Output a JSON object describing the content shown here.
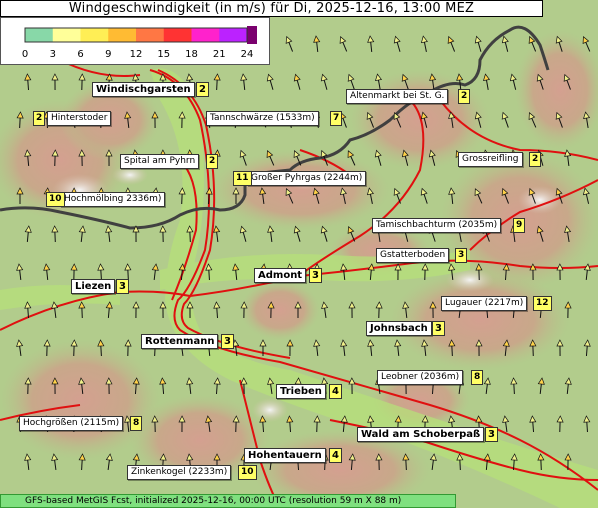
{
  "title": "Windgeschwindigkeit (in m/s) für Di, 2025-12-16, 13:00 MEZ",
  "legend": {
    "ticks": [
      "0",
      "3",
      "6",
      "9",
      "12",
      "15",
      "18",
      "21",
      "24"
    ],
    "colors": [
      "#88d8a8",
      "#ffff99",
      "#ffee55",
      "#ffbb33",
      "#ff7744",
      "#ff3333",
      "#ff22cc",
      "#bb22ff",
      "#7a006e"
    ]
  },
  "places": [
    {
      "name": "Windischgarsten",
      "value": "2",
      "bold": true
    },
    {
      "name": "Hinterstoder",
      "value": "2",
      "bold": false
    },
    {
      "name": "Tannschwärze (1533m)",
      "value": "7",
      "bold": false
    },
    {
      "name": "Altenmarkt bei St. G.",
      "value": "2",
      "bold": false
    },
    {
      "name": "Spital am Pyhrn",
      "value": "2",
      "bold": false
    },
    {
      "name": "Grossreifling",
      "value": "2",
      "bold": false
    },
    {
      "name": "Großer Pyhrgas (2244m)",
      "value": "11",
      "bold": false
    },
    {
      "name": "Hochmölbing 2336m)",
      "value": "10",
      "bold": false
    },
    {
      "name": "Tamischbachturm (2035m)",
      "value": "9",
      "bold": false
    },
    {
      "name": "Gstatterboden",
      "value": "3",
      "bold": false
    },
    {
      "name": "Admont",
      "value": "3",
      "bold": true
    },
    {
      "name": "Liezen",
      "value": "3",
      "bold": true
    },
    {
      "name": "Lugauer (2217m)",
      "value": "12",
      "bold": false
    },
    {
      "name": "Johnsbach",
      "value": "3",
      "bold": true
    },
    {
      "name": "Rottenmann",
      "value": "3",
      "bold": true
    },
    {
      "name": "Leobner (2036m)",
      "value": "8",
      "bold": false
    },
    {
      "name": "Trieben",
      "value": "4",
      "bold": true
    },
    {
      "name": "Hochgrößen (2115m)",
      "value": "8",
      "bold": false
    },
    {
      "name": "Wald am Schoberpaß",
      "value": "3",
      "bold": true
    },
    {
      "name": "Hohentauern",
      "value": "4",
      "bold": true
    },
    {
      "name": "Zinkenkogel (2233m)",
      "value": "10",
      "bold": false
    }
  ],
  "footer": "GFS-based MetGIS Fcst, initialized 2025-12-16, 00:00 UTC  (resolution 59 m X 88 m)"
}
